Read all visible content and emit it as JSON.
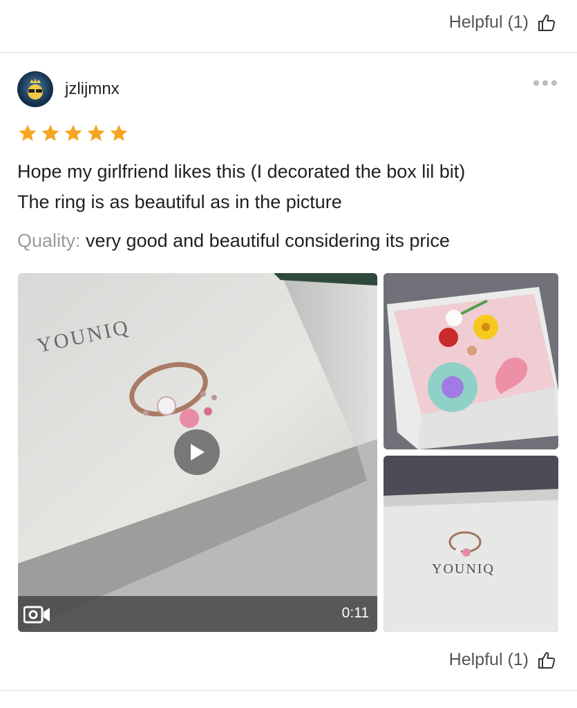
{
  "helpful_top": {
    "label": "Helpful (1)"
  },
  "review": {
    "username": "jzlijmnx",
    "rating": 5,
    "text_line1": "Hope my girlfriend likes this (I decorated the box lil bit)",
    "text_line2": "The ring is as beautiful as in the picture",
    "quality_label": "Quality:",
    "quality_value": " very good and beautiful considering its price",
    "media": {
      "video_duration": "0:11",
      "box_brand_text": "YOUNIQ"
    }
  },
  "helpful_bottom": {
    "label": "Helpful (1)"
  },
  "colors": {
    "star": "#f5a623",
    "label_gray": "#9a9a9a"
  },
  "icons": [
    "thumbs-up-icon",
    "more-icon",
    "star-icon",
    "play-icon",
    "video-camera-icon"
  ]
}
